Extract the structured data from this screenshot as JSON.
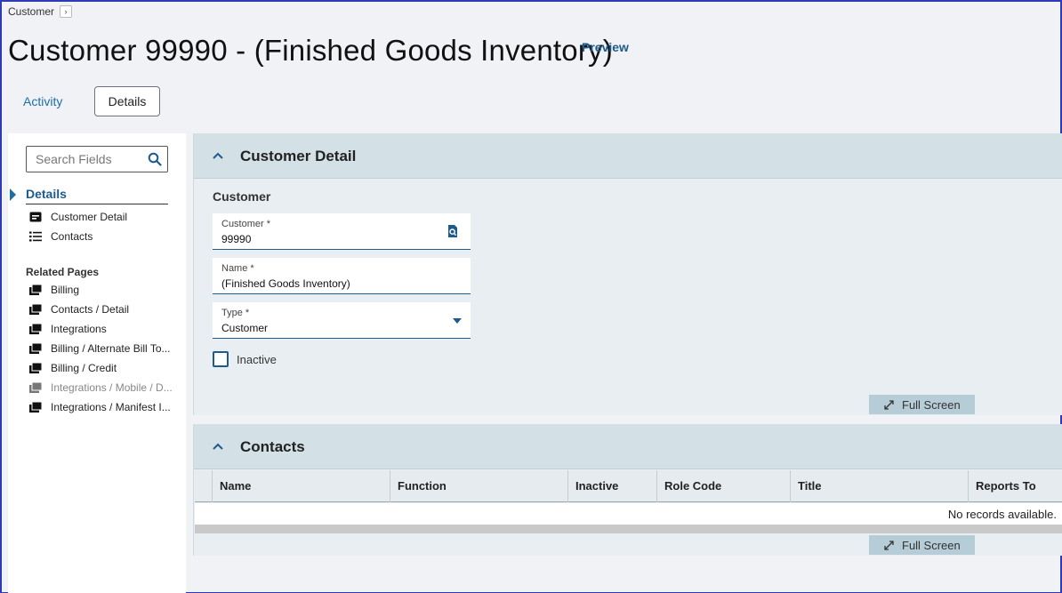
{
  "breadcrumb": {
    "label": "Customer",
    "chevron": "chevron-right-icon"
  },
  "page": {
    "title": "Customer 99990 - (Finished Goods Inventory)",
    "preview_label": "Preview"
  },
  "tabs": {
    "activity": "Activity",
    "details": "Details"
  },
  "leftnav": {
    "search_placeholder": "Search Fields",
    "details_heading": "Details",
    "detail_items": [
      "Customer Detail",
      "Contacts"
    ],
    "related_title": "Related Pages",
    "related_items": [
      "Billing",
      "Contacts / Detail",
      "Integrations",
      "Billing / Alternate Bill To...",
      "Billing / Credit",
      "Integrations / Mobile / D...",
      "Integrations / Manifest I..."
    ]
  },
  "customer_detail": {
    "title": "Customer Detail",
    "section_label": "Customer",
    "customer_field": {
      "label": "Customer *",
      "value": "99990"
    },
    "name_field": {
      "label": "Name *",
      "value": "(Finished Goods Inventory)"
    },
    "type_field": {
      "label": "Type *",
      "value": "Customer"
    },
    "inactive_label": "Inactive",
    "inactive_checked": false,
    "fullscreen_label": "Full Screen"
  },
  "contacts": {
    "title": "Contacts",
    "columns": [
      "Name",
      "Function",
      "Inactive",
      "Role Code",
      "Title",
      "Reports To"
    ],
    "empty_message": "No records available.",
    "fullscreen_label": "Full Screen"
  },
  "colors": {
    "accent": "#1d5b8c",
    "link": "#1d6fa8",
    "panel_header": "#d3e0e6",
    "fullscreen_button": "#b6ccd7"
  }
}
